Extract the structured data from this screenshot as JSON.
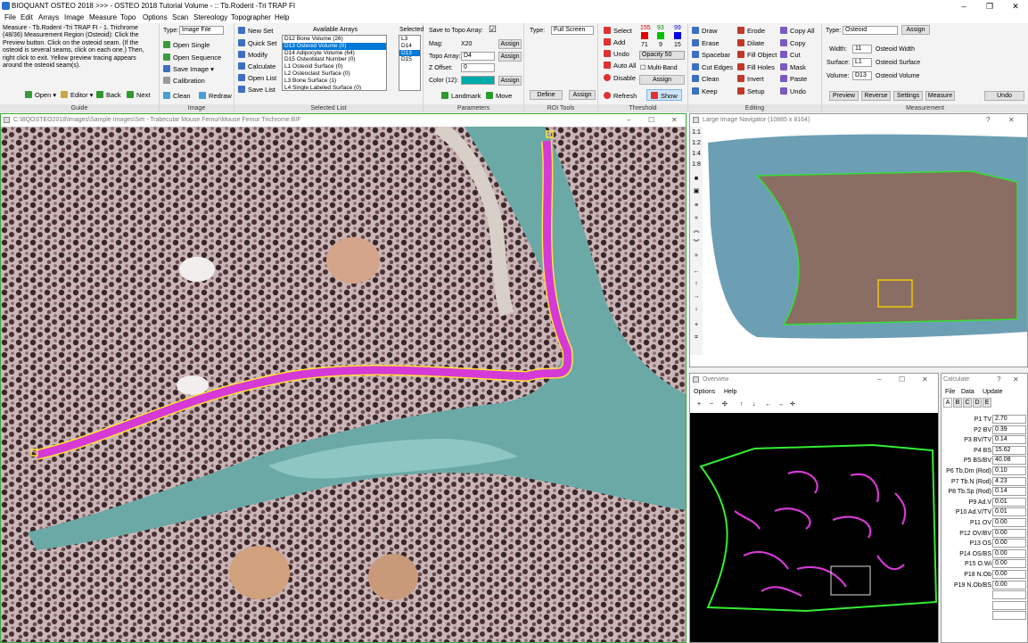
{
  "app": {
    "title": "BIOQUANT OSTEO 2018  >>>  - OSTEO 2018 Tutorial Volume - :: Tb.Rodent -Tri TRAP FI",
    "window_controls": [
      "–",
      "❐",
      "✕"
    ]
  },
  "menu": [
    "File",
    "Edit",
    "Arrays",
    "Image",
    "Measure",
    "Topo",
    "Options",
    "Scan",
    "Stereology",
    "Topographer",
    "Help"
  ],
  "guide": {
    "text": "Measure - Tb.Rodent -Tri TRAP FI - 1. Trichrome (48/36) Measurement Region (Osteoid): Click the Preview button. Click on the osteoid seam. (If the osteoid is several seams, click on each one.) Then, right click to exit. Yellow preview tracing appears around the osteoid seam(s).",
    "buttons": [
      "Open ▾",
      "Editor ▾",
      "Back",
      "Next"
    ],
    "caption": "Guide"
  },
  "image_group": {
    "type_label": "Type:",
    "type_value": "Image File",
    "buttons": [
      "Open Single",
      "Open Sequence",
      "Save Image ▾",
      "Calibration",
      "Clean",
      "Redraw"
    ],
    "caption": "Image"
  },
  "selected_list": {
    "buttons": [
      "New Set",
      "Quick Set",
      "Modify",
      "Calculate",
      "Open List",
      "Save List"
    ],
    "available_label": "Available Arrays",
    "available": [
      "D12 Bone Volume (26)",
      "D13 Osteoid Volume (0)",
      "D14 Adipocyte Volume (64)",
      "D15 Osteoblast Number (0)",
      "L1 Osteoid Surface (0)",
      "L2 Osteoclast Surface (0)",
      "L3 Bone Surface (1)",
      "L4 Single Labeled Surface (0)"
    ],
    "available_selected": 1,
    "selected_label": "Selected",
    "selected": [
      "L3",
      "D14",
      "D13",
      "D15"
    ],
    "selected_selected": 2,
    "caption": "Selected List"
  },
  "parameters": {
    "save_topo_label": "Save to Topo Array:",
    "save_topo_checked": "☑",
    "mag_label": "Mag:",
    "mag_value": "X20",
    "topo_array_label": "Topo Array:",
    "topo_array_value": "D4",
    "zoffset_label": "Z Offset:",
    "zoffset_value": "0",
    "color_label": "Color (12):",
    "assign": "Assign",
    "landmark": "Landmark",
    "move": "Move",
    "caption": "Parameters"
  },
  "roi": {
    "type_label": "Type:",
    "type_value": "Full Screen",
    "define": "Define",
    "assign": "Assign",
    "caption": "ROI Tools"
  },
  "threshold": {
    "buttons": [
      "Select",
      "Add",
      "Undo",
      "Auto All",
      "Disable"
    ],
    "rgb_top": [
      "155",
      "93",
      "99"
    ],
    "rgb_bottom": [
      "71",
      "9",
      "15"
    ],
    "colors": [
      "#e00000",
      "#00c000",
      "#0000e0"
    ],
    "opacity": "Opacity 50",
    "multiband": "Multi-Band",
    "assign": "Assign",
    "refresh": "Refresh",
    "show": "Show",
    "caption": "Threshold"
  },
  "editing": {
    "col1": [
      "Draw",
      "Erase",
      "Spacebar",
      "Cut Edges",
      "Clean",
      "Keep"
    ],
    "col2": [
      "Erode",
      "Dilate",
      "Fill Object",
      "Fill Holes",
      "Invert",
      "Setup"
    ],
    "col3": [
      "Copy All",
      "Copy",
      "Cut",
      "Mask",
      "Paste",
      "Undo"
    ],
    "caption": "Editing"
  },
  "measurement": {
    "type_label": "Type:",
    "type_value": "Osteoid",
    "assign": "Assign",
    "width_label": "Width:",
    "width_value": "11",
    "width_name": "Osteoid Width",
    "surface_label": "Surface:",
    "surface_value": "L1",
    "surface_name": "Osteoid Surface",
    "volume_label": "Volume:",
    "volume_value": "D13",
    "volume_name": "Osteoid Volume",
    "buttons": [
      "Preview",
      "Reverse",
      "Settings",
      "Measure"
    ],
    "undo": "Undo",
    "caption": "Measurement"
  },
  "image_window": {
    "title": "C:\\BQOSTEO2018\\Images\\Sample Images\\Set - Trabecular Mouse Femur\\Mouse Femur Trichrome.BIF"
  },
  "navigator": {
    "title": "Large Image Navigator (10885 x 8164)",
    "zoom": [
      "1:1",
      "1:2",
      "1:4",
      "1:8"
    ]
  },
  "overview": {
    "title": "Overview",
    "menu": [
      "Options",
      "Help"
    ],
    "tools": [
      "+",
      "−",
      "✣",
      "↑",
      "↓",
      "←",
      "→",
      "✛"
    ]
  },
  "calculate": {
    "title": "Calculate",
    "menu": [
      "File",
      "Data",
      "Update"
    ],
    "tabs": [
      "A",
      "B",
      "C",
      "D",
      "E"
    ],
    "rows": [
      {
        "n": "P1 TV",
        "v": "2.70"
      },
      {
        "n": "P2 BV",
        "v": "0.39"
      },
      {
        "n": "P3 BV/TV",
        "v": "0.14"
      },
      {
        "n": "P4 BS",
        "v": "15.62"
      },
      {
        "n": "P5 BS/BV",
        "v": "40.08"
      },
      {
        "n": "P6 Tb.Dm (Rod)",
        "v": "0.10"
      },
      {
        "n": "P7 Tb.N (Rod)",
        "v": "4.23"
      },
      {
        "n": "P8 Tb.Sp (Rod)",
        "v": "0.14"
      },
      {
        "n": "P9 Ad.V",
        "v": "0.01"
      },
      {
        "n": "P10 Ad.V/TV",
        "v": "0.01"
      },
      {
        "n": "P11 OV",
        "v": "0.00"
      },
      {
        "n": "P12 OV/BV",
        "v": "0.00"
      },
      {
        "n": "P13 OS",
        "v": "0.00"
      },
      {
        "n": "P14 OS/BS",
        "v": "0.00"
      },
      {
        "n": "P15 O.Wi",
        "v": "0.00"
      },
      {
        "n": "P18 N.Ob",
        "v": "0.00"
      },
      {
        "n": "P19 N.Ob/BS",
        "v": "0.00"
      }
    ]
  }
}
